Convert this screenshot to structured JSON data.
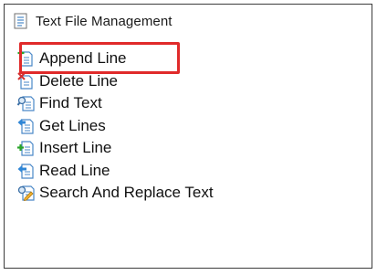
{
  "header": {
    "title": "Text File Management",
    "icon": "file-list-icon"
  },
  "items": [
    {
      "label": "Append Line",
      "icon": "append-line-icon"
    },
    {
      "label": "Delete Line",
      "icon": "delete-line-icon"
    },
    {
      "label": "Find Text",
      "icon": "find-text-icon"
    },
    {
      "label": "Get Lines",
      "icon": "get-lines-icon"
    },
    {
      "label": "Insert Line",
      "icon": "insert-line-icon"
    },
    {
      "label": "Read Line",
      "icon": "read-line-icon"
    },
    {
      "label": "Search And Replace Text",
      "icon": "search-replace-icon"
    }
  ],
  "colors": {
    "highlight": "#e02a2a",
    "border": "#3c3c3c",
    "doc_blue": "#4a88c8",
    "add_green": "#2aa52a",
    "delete_red": "#d23030"
  }
}
